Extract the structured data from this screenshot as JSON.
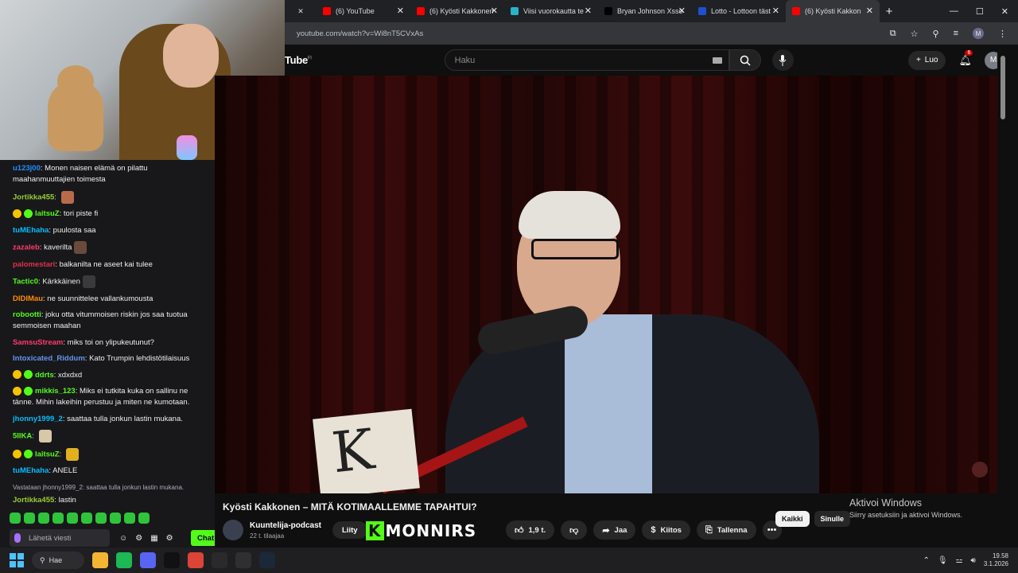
{
  "browser": {
    "tabs": [
      {
        "label": "(6) YouTube",
        "favicon_color": "#ff0000"
      },
      {
        "label": "(6) Kyösti Kakkonen",
        "favicon_color": "#ff0000"
      },
      {
        "label": "Viisi vuorokautta te",
        "favicon_color": "#27b3c9"
      },
      {
        "label": "Bryan Johnson Xsso",
        "favicon_color": "#000000"
      },
      {
        "label": "Lotto - Lottoon täst",
        "favicon_color": "#1f4fd1"
      },
      {
        "label": "(6) Kyösti Kakkon",
        "favicon_color": "#ff0000",
        "active": true
      }
    ],
    "close_glyph": "✕",
    "new_tab_glyph": "+",
    "window_controls": [
      "—",
      "☐",
      "✕"
    ],
    "url": "youtube.com/watch?v=Wi8nT5CVxAs",
    "profile_initial": "M"
  },
  "youtube": {
    "logo_text": "Tube",
    "logo_region": "FI",
    "search_placeholder": "Haku",
    "create_label": "Luo",
    "notification_count": "6",
    "avatar_initial": "M",
    "video_title": "Kyösti Kakkonen – MITÄ KOTIMAALLEMME TAPAHTUI?",
    "channel_name": "Kuuntelija-podcast",
    "subscribers": "22 t. tilaajaa",
    "join_label": "Liity",
    "likes": "1,9 t.",
    "share_label": "Jaa",
    "thanks_label": "Kiitos",
    "save_label": "Tallenna",
    "more_glyph": "•••",
    "filter_chips": [
      {
        "label": "Kaikki",
        "selected": true
      },
      {
        "label": "Sinulle",
        "selected": false
      }
    ]
  },
  "overlay": {
    "logo_k": "K",
    "logo_text": "MONNIRS",
    "video_book_letter": "K"
  },
  "windows_activation": {
    "title": "Aktivoi Windows",
    "subtitle": "Siirry asetuksiin ja aktivoi Windows."
  },
  "chat": {
    "messages": [
      {
        "user": "u123j00",
        "color": "#1e90ff",
        "text": "Monen naisen elämä on pilattu maahanmuuttajien toimesta"
      },
      {
        "user": "Jortikka455",
        "color": "#9acd32",
        "text": "",
        "emote": "#b86b4a"
      },
      {
        "user": "laitsuZ",
        "color": "#53fc18",
        "text": "tori piste fi",
        "badges": true
      },
      {
        "user": "tuMEhaha",
        "color": "#00bfff",
        "text": "puulosta saa"
      },
      {
        "user": "zazaleb",
        "color": "#ff3b6b",
        "text": "kaverilta",
        "emote": "#6a4a3a"
      },
      {
        "user": "palomestari",
        "color": "#e0304a",
        "text": "balkanilta ne aseet kai tulee"
      },
      {
        "user": "Tactic0",
        "color": "#53fc18",
        "text": "Kärkkäinen",
        "emote": "#3a3a3a"
      },
      {
        "user": "DIDIMau",
        "color": "#ff8c00",
        "text": "ne suunnittelee vallankumousta"
      },
      {
        "user": "robootti",
        "color": "#53fc18",
        "text": "joku otta vitummoisen riskin jos saa tuotua semmoisen maahan"
      },
      {
        "user": "SamsuStream",
        "color": "#ff3b6b",
        "text": "miks toi on ylipukeutunut?"
      },
      {
        "user": "Intoxicated_Riddum",
        "color": "#6495ed",
        "text": "Kato Trumpin lehdistötilaisuus"
      },
      {
        "user": "ddrts",
        "color": "#53fc18",
        "text": "xdxdxd",
        "badges": true
      },
      {
        "user": "mikkis_123",
        "color": "#53fc18",
        "text": "Miks ei tutkita kuka on sallinu ne tänne. Mihin lakeihin perustuu ja miten ne kumotaan.",
        "badges": true
      },
      {
        "user": "jhonny1999_2",
        "color": "#00bfff",
        "text": "saattaa tulla jonkun lastin mukana."
      },
      {
        "user": "5IIKA",
        "color": "#53fc18",
        "text": "",
        "emote": "#d8c8a8"
      },
      {
        "user": "laitsuZ",
        "color": "#53fc18",
        "text": "",
        "emote": "#e0b020",
        "badges": true
      },
      {
        "user": "tuMEhaha",
        "color": "#00bfff",
        "text": "ANELE"
      }
    ],
    "reply_context": "Vastataan jhonny1999_2: saattaa tulla jonkun lastin mukana.",
    "reply": {
      "user": "Jortikka455",
      "color": "#9acd32",
      "text": "lastin"
    },
    "last_message": {
      "user": "Tactic0",
      "color": "#53fc18",
      "text": ""
    },
    "input_placeholder": "Lähetä viesti",
    "send_label": "Chat",
    "tool_icons": [
      "☺",
      "⚙",
      "▦",
      "⚙"
    ]
  },
  "taskbar": {
    "search_label": "Hae",
    "apps": [
      {
        "name": "file-explorer",
        "color": "#f2b632"
      },
      {
        "name": "spotify",
        "color": "#1db954"
      },
      {
        "name": "discord",
        "color": "#5865f2"
      },
      {
        "name": "x-app",
        "color": "#111111"
      },
      {
        "name": "chrome",
        "color": "#db4437"
      },
      {
        "name": "notion",
        "color": "#2a2a2a"
      },
      {
        "name": "obs",
        "color": "#302e31"
      },
      {
        "name": "steam",
        "color": "#1b2838"
      }
    ],
    "time": "19.58",
    "date": "3.1.2026"
  }
}
